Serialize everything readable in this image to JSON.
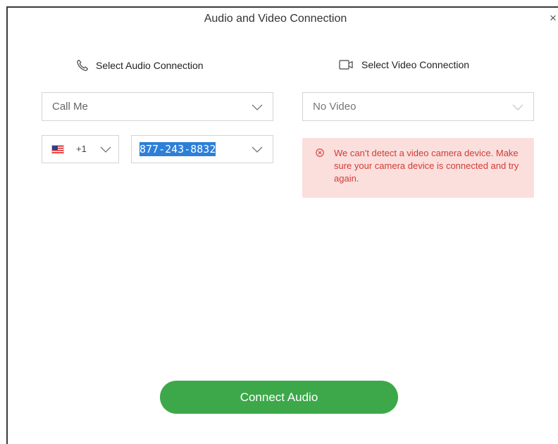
{
  "dialog": {
    "title": "Audio and Video Connection",
    "close_symbol": "×"
  },
  "audio": {
    "heading": "Select Audio Connection",
    "heading_icon": "phone-icon",
    "dropdown_value": "Call Me",
    "country_icon": "us-flag-icon",
    "country_code": "+1",
    "phone_number": "877-243-8832"
  },
  "video": {
    "heading": "Select Video Connection",
    "heading_icon": "video-camera-icon",
    "dropdown_value": "No Video",
    "error_icon": "error-circle-icon",
    "error_message": "We can't detect a video camera device. Make sure your camera device is connected and try again."
  },
  "actions": {
    "connect_label": "Connect Audio"
  },
  "colors": {
    "accent_green": "#3da84a",
    "error_text": "#d23c36",
    "error_bg": "#fadfdd",
    "selection_blue": "#2d7fd8"
  }
}
